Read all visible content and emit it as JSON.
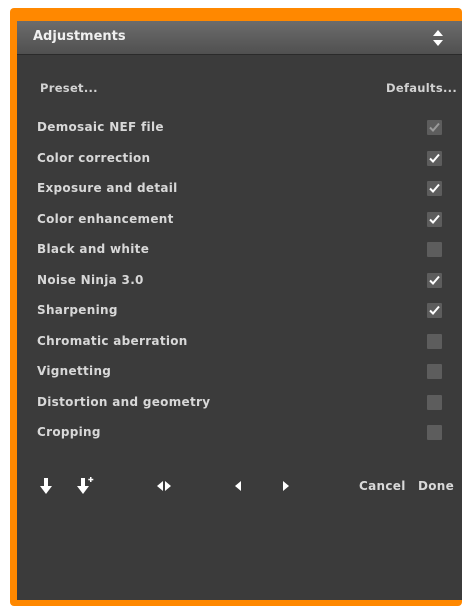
{
  "panel": {
    "title": "Adjustments",
    "preset_label": "Preset...",
    "defaults_label": "Defaults..."
  },
  "steps": [
    {
      "label": "Demosaic NEF file",
      "checked": true,
      "enabled": false
    },
    {
      "label": "Color correction",
      "checked": true,
      "enabled": true
    },
    {
      "label": "Exposure and detail",
      "checked": true,
      "enabled": true
    },
    {
      "label": "Color enhancement",
      "checked": true,
      "enabled": true
    },
    {
      "label": "Black and white",
      "checked": false,
      "enabled": true
    },
    {
      "label": "Noise Ninja 3.0",
      "checked": true,
      "enabled": true
    },
    {
      "label": "Sharpening",
      "checked": true,
      "enabled": true
    },
    {
      "label": "Chromatic aberration",
      "checked": false,
      "enabled": true
    },
    {
      "label": "Vignetting",
      "checked": false,
      "enabled": true
    },
    {
      "label": "Distortion and geometry",
      "checked": false,
      "enabled": true
    },
    {
      "label": "Cropping",
      "checked": false,
      "enabled": true
    }
  ],
  "toolbar": {
    "icons": [
      "move-down-icon",
      "move-down-plus-icon",
      "compare-icon",
      "previous-icon",
      "next-icon"
    ],
    "cancel_label": "Cancel",
    "done_label": "Done"
  },
  "colors": {
    "frame": "#ff8800",
    "panel_bg": "#3b3b3b",
    "text": "#d8d8d8"
  }
}
